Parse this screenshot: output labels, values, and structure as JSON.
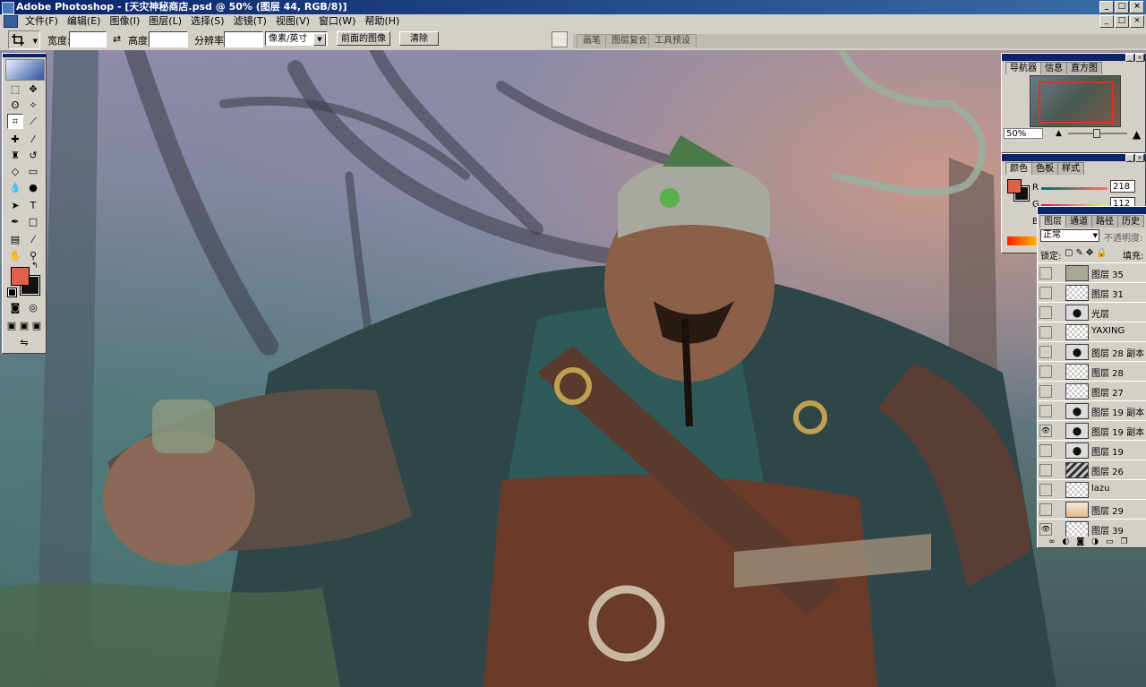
{
  "window": {
    "title": "Adobe Photoshop - [天灾神秘商店.psd @ 50% (图层 44, RGB/8)]",
    "btn_min": "_",
    "btn_max": "□",
    "btn_close": "×"
  },
  "menu": {
    "items": [
      "文件(F)",
      "编辑(E)",
      "图像(I)",
      "图层(L)",
      "选择(S)",
      "滤镜(T)",
      "视图(V)",
      "窗口(W)",
      "帮助(H)"
    ],
    "doc_min": "_",
    "doc_max": "□",
    "doc_close": "×"
  },
  "options": {
    "width_label": "宽度:",
    "width_value": "",
    "swap": "⇄",
    "height_label": "高度:",
    "height_value": "",
    "resolution_label": "分辨率:",
    "resolution_value": "",
    "unit_select": "像素/英寸",
    "front_image_btn": "前面的图像",
    "clear_btn": "清除",
    "well_tabs": [
      "画笔",
      "图层复合",
      "工具预设"
    ]
  },
  "navigator": {
    "tabs": [
      "导航器",
      "信息",
      "直方图"
    ],
    "zoom": "50%"
  },
  "color": {
    "tabs": [
      "颜色",
      "色板",
      "样式"
    ],
    "channels": [
      {
        "label": "R",
        "value": "218"
      },
      {
        "label": "G",
        "value": "112"
      },
      {
        "label": "B",
        "value": ""
      }
    ],
    "fg": "#e0604a",
    "bg": "#111111"
  },
  "layers": {
    "tabs": [
      "图层",
      "通道",
      "路径",
      "历史"
    ],
    "blend_mode": "正常",
    "opacity_label": "不透明度:",
    "lock_label": "锁定:",
    "fill_label": "填充:",
    "items": [
      {
        "name": "图层 35",
        "thumb": "solid",
        "visible": false
      },
      {
        "name": "图层 31",
        "thumb": "transparent",
        "visible": false
      },
      {
        "name": "光层",
        "thumb": "fig",
        "visible": false
      },
      {
        "name": "YAXING",
        "thumb": "transparent",
        "visible": false
      },
      {
        "name": "图层 28 副本",
        "thumb": "fig",
        "visible": false
      },
      {
        "name": "图层 28",
        "thumb": "transparent",
        "visible": false
      },
      {
        "name": "图层 27",
        "thumb": "transparent",
        "visible": false
      },
      {
        "name": "图层 19 副本 2",
        "thumb": "fig",
        "visible": false
      },
      {
        "name": "图层 19 副本",
        "thumb": "fig",
        "visible": true
      },
      {
        "name": "图层 19",
        "thumb": "fig",
        "visible": false
      },
      {
        "name": "图层 26",
        "thumb": "stripe",
        "visible": false
      },
      {
        "name": "lazu",
        "thumb": "transparent",
        "visible": false
      },
      {
        "name": "图层 29",
        "thumb": "skin",
        "visible": false
      },
      {
        "name": "图层 39",
        "thumb": "transparent",
        "visible": true
      }
    ]
  },
  "toolbox": {
    "tools": [
      "marquee-tool",
      "move-tool",
      "lasso-tool",
      "magic-wand-tool",
      "crop-tool",
      "slice-tool",
      "healing-brush-tool",
      "brush-tool",
      "clone-stamp-tool",
      "history-brush-tool",
      "eraser-tool",
      "gradient-tool",
      "blur-tool",
      "dodge-tool",
      "path-selection-tool",
      "type-tool",
      "pen-tool",
      "shape-tool",
      "notes-tool",
      "eyedropper-tool",
      "hand-tool",
      "zoom-tool"
    ]
  },
  "icons": {
    "eye": "eye-icon",
    "crop": "crop-icon",
    "dropdown": "chevron-down-icon"
  }
}
